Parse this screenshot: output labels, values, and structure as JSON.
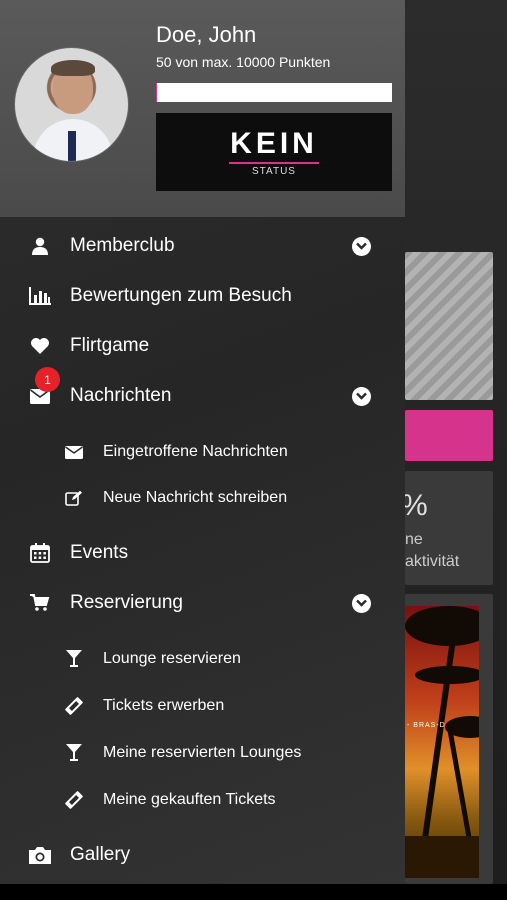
{
  "profile": {
    "name": "Doe, John",
    "points_text": "50  von max. 10000 Punkten",
    "progress_fraction": 0.005,
    "status_title": "KEIN",
    "status_subtitle": "STATUS"
  },
  "menu": {
    "memberclub": "Memberclub",
    "bewertungen": "Bewertungen zum Besuch",
    "flirtgame": "Flirtgame",
    "nachrichten": "Nachrichten",
    "nachrichten_badge": "1",
    "eingetroffene": "Eingetroffene Nachrichten",
    "neue_nachricht": "Neue Nachricht schreiben",
    "events": "Events",
    "reservierung": "Reservierung",
    "lounge_reservieren": "Lounge reservieren",
    "tickets_erwerben": "Tickets erwerben",
    "meine_lounges": "Meine reservierten Lounges",
    "meine_tickets": "Meine gekauften Tickets",
    "gallery": "Gallery"
  },
  "background": {
    "stat_pct": "%",
    "stat_line1": "ne",
    "stat_line2": "aktivität",
    "poster_text": "- BRAS-D"
  },
  "colors": {
    "accent": "#d6338c",
    "badge": "#e5222a",
    "drawer_bg": "#2a2a2a",
    "header_bg": "#555555"
  }
}
